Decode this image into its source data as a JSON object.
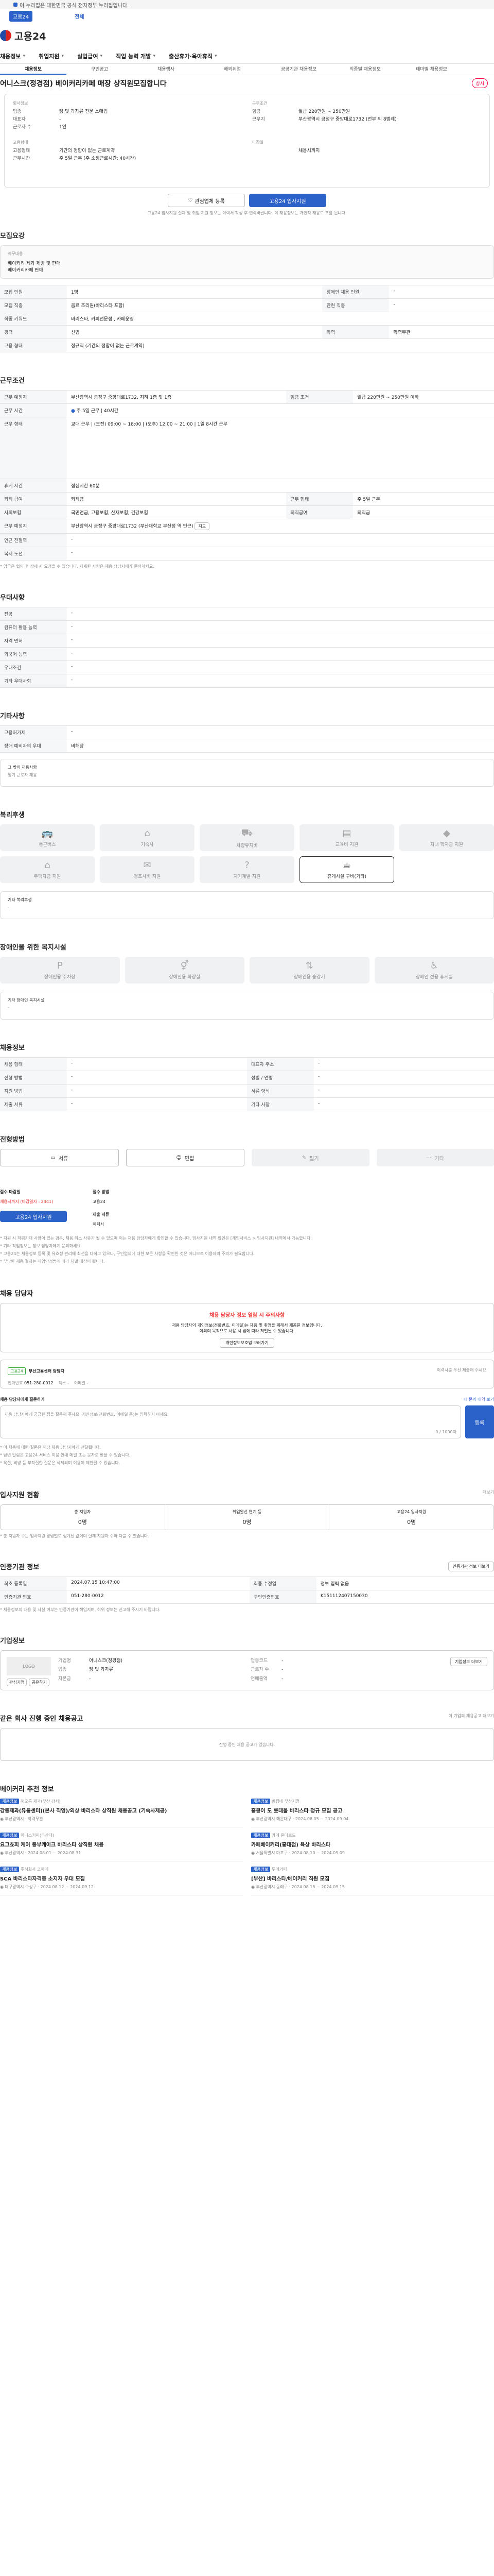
{
  "gov_banner": {
    "text": "이 누리집은 대한민국 공식 전자정부 누리집입니다."
  },
  "site_bar": {
    "pill": "고용24",
    "all_menu": "전체"
  },
  "header": {
    "logo_text": "고용24"
  },
  "gnb": [
    "채용정보",
    "취업지원",
    "실업급여",
    "직업 능력 개발",
    "출산휴가·육아휴직"
  ],
  "tabs": [
    "채용정보",
    "구인공고",
    "채용행사",
    "해외취업",
    "공공기관 채용정보",
    "직종별 채용정보",
    "테마별 채용정보"
  ],
  "job": {
    "title": "어니스크(정경점) 베이커리카페 매장 상직원모집합니다",
    "badge": "상시",
    "company_label": "회사정보",
    "company_rows": [
      {
        "k": "업종",
        "v": "빵 및 과자류 전문 소매업"
      },
      {
        "k": "대표자",
        "v": "-"
      },
      {
        "k": "근로자 수",
        "v": "1인"
      }
    ],
    "apply_label": "근무조건",
    "apply_rows": [
      {
        "k": "임금",
        "v": "월급 220만원 ~ 250만원"
      },
      {
        "k": "근무지",
        "v": "부산광역시 금정구 중앙대로1732 (전부 외 8범례)"
      }
    ],
    "req_label": "고용형태",
    "req_rows": [
      {
        "k": "고용형태",
        "v": "기간의 정함이 없는 근로계약"
      },
      {
        "k": "근무시간",
        "v": "주 5일 근무 (주 소정근로시간: 40시간)"
      }
    ],
    "deadline_label": "마감일",
    "deadline_value": "채용시까지",
    "btn_interest": "관심업체 등록",
    "btn_apply": "고용24 입사지원",
    "notice": "고용24 입사지원 절차 및 취업 지원 정보는 이력서 작성 후 연락바랍니다. 이 채용정보는 개인적 채용도 포함 됩니다."
  },
  "recruit": {
    "title": "모집요강",
    "box_rows": [
      "직무내용",
      "베이커리 제과 제빵 및 판매",
      "베이커리카페 판매"
    ],
    "rows": [
      {
        "k": "모집 인원",
        "v": "1명",
        "k2": "장애인 채용 인원",
        "v2": "-"
      },
      {
        "k": "모집 직종",
        "v": "음료 조리원(바리스타 포함)",
        "k2": "관련 직종",
        "v2": "-"
      },
      {
        "k": "직종 키워드",
        "v": "바리스타, 커피전문점 , 카페운영",
        "k2": "",
        "v2": ""
      },
      {
        "k": "경력",
        "v": "신입",
        "k2": "학력",
        "v2": "학력무관"
      },
      {
        "k": "고용 형태",
        "v": "정규직 (기간의 정함이 없는 근로계약)",
        "k2": "",
        "v2": ""
      }
    ]
  },
  "work": {
    "title": "근무조건",
    "rows": [
      {
        "k": "근무 예정지",
        "v": "부산광역시 금정구 중앙대로1732, 지하 1층 및 1층",
        "k2": "임금 조건",
        "v2": "월급 220만원 ~ 250만원 이하"
      },
      {
        "k": "근무 시간",
        "v": "주 5일 근무 | 40시간",
        "k2": "",
        "v2": ""
      },
      {
        "k": "근무 형태",
        "v": "교대 근무 | (오전) 09:00 ~ 18:00 | (오후) 12:00 ~ 21:00 | 1일 8시간 근무",
        "k2": "",
        "v2": ""
      },
      {
        "k": "휴게 시간",
        "v": "점심시간 60분",
        "k2": "",
        "v2": ""
      },
      {
        "k": "퇴직 급여",
        "v": "퇴직금",
        "k2": "근무 형태",
        "v2": "주 5일 근무"
      },
      {
        "k": "사회보험",
        "v": "국민연금, 고용보험, 산재보험, 건강보험",
        "k2": "퇴직급여",
        "v2": "퇴직금"
      },
      {
        "k": "근무 예정지",
        "v": "부산광역시 금정구 중앙대로1732 (부산대학교 부산정 역 인근)",
        "k2": "",
        "v2": ""
      },
      {
        "k": "인근 전철역",
        "v": "-",
        "k2": "",
        "v2": ""
      },
      {
        "k": "복지 노선",
        "v": "-",
        "k2": "",
        "v2": ""
      }
    ],
    "note": "* 임금은 협의 후 상세 시 요청을 수 있습니다. 자세한 사항은 채용 담당자에게 문의하세요."
  },
  "pref": {
    "title": "우대사항",
    "rows": [
      {
        "k": "전공",
        "v": "-"
      },
      {
        "k": "컴퓨터 활용 능력",
        "v": "-"
      },
      {
        "k": "자격 면허",
        "v": "-"
      },
      {
        "k": "외국어 능력",
        "v": "-"
      },
      {
        "k": "우대조건",
        "v": "-"
      },
      {
        "k": "기타 우대사항",
        "v": "-"
      }
    ]
  },
  "etc": {
    "title": "기타사항",
    "rows": [
      {
        "k": "고용허가제",
        "v": "-"
      },
      {
        "k": "장애 예비자의 우대",
        "v": "비해당"
      }
    ],
    "box_title": "그 밖의 채용사항",
    "box_text": "정기 근로자 채용"
  },
  "welfare": {
    "title": "복리후생",
    "icons": [
      "통근버스",
      "기숙사",
      "차량유지비",
      "교육비 지원",
      "자녀 학자금 지원",
      "주택자금 지원",
      "경조사비 지원",
      "자기계발 지원",
      "휴게시설 구비(기타)"
    ],
    "box_title": "기타 복리후생",
    "box_text": "-"
  },
  "disabled": {
    "title": "장애인을 위한 복지시설",
    "icons": [
      "장애인용 주차장",
      "장애인용 화장실",
      "장애인용 승강기",
      "장애인 전용 휴게실"
    ],
    "box_title": "기타 장애인 복지시설",
    "box_text": "-"
  },
  "company": {
    "title": "채용정보",
    "rows": [
      {
        "k": "채용 형태",
        "v": "-",
        "k2": "",
        "v2": ""
      },
      {
        "k": "전형 방법",
        "v": "-",
        "k2": "",
        "v2": ""
      },
      {
        "k": "지원 방법",
        "v": "-",
        "k2": "",
        "v2": ""
      },
      {
        "k": "제출 서류",
        "v": "-",
        "k2": "",
        "v2": ""
      }
    ],
    "side_rows": [
      {
        "k": "대표자 주소",
        "v": "-"
      },
      {
        "k": "성별 / 연령",
        "v": "-"
      },
      {
        "k": "서류 양식",
        "v": "-"
      },
      {
        "k": "기타 사항",
        "v": "-"
      }
    ]
  },
  "process": {
    "title": "전형방법",
    "steps": [
      "서류",
      "면접",
      "필기",
      "기타"
    ]
  },
  "apply": {
    "deadline_k": "접수 마감일",
    "deadline_v": "채용시까지 (마감일자 : 2441)",
    "method_k": "접수 방법",
    "method_v": "고용24",
    "btn": "고용24 입사지원",
    "docs_k": "제출 서류",
    "docs_v": "이력서",
    "notes": [
      "* 지원 시 허위기재 사항이 있는 경우, 채용 취소 사유가 될 수 있으며 이는 채용 담당자에게 확인할 수 있습니다. 입사지원 내역 확인은 [개인서비스 > 입사지원] 내역에서 가능합니다.",
      "* 기타 직업정보는 정보 담당자에게 문의하세요.",
      "* 고용24는 채용정보 등록 및 유효성 관리에 최선을 다하고 있으나, 구인업체에 대한 모든 사항을 확인한 것은 아니므로 이용자의 주의가 필요합니다.",
      "* 부당한 채용 절차는 직업안정법에 따라 처벌 대상이 됩니다."
    ]
  },
  "contact": {
    "title": "채용 담당자",
    "notice_title": "채용 담당자 정보 열람 시 주의사항",
    "notice_lines": [
      "채용 담당자의 개인정보(전화번호, 이메일)는 채용 및 취업을 위해서 제공된 정보입니다.",
      "이외의 목적으로 사용 시 법에 따라 처벌될 수 있습니다."
    ],
    "notice_btn": "개인정보보호법 보러가기",
    "badge": "고용24",
    "name": "부산고용센터 담당자",
    "phone_k": "전화번호",
    "phone_v": "051-280-0012",
    "fax_k": "팩스",
    "fax_v": "-",
    "email_k": "이메일",
    "email_v": "-",
    "side_note": "이력서를 우선 제출해 주세요",
    "q_title": "채용 담당자에게 질문하기",
    "q_link": "내 문의 내역 보기",
    "q_placeholder": "채용 담당자에게 궁금한 점을 질문해 주세요. 개인정보(전화번호, 이메일 등)는 입력하지 마세요.",
    "q_count": "0 / 1000자",
    "q_btn": "등록",
    "q_notes": [
      "* 이 채용에 대한 질문은 해당 채용 담당자에게 전달됩니다.",
      "* 답변 알림은 고용24 서비스 이용 안내 메일 또는 문자로 받을 수 있습니다.",
      "* 욕설, 비방 등 부적절한 질문은 삭제되며 이용이 제한될 수 있습니다."
    ]
  },
  "applicants": {
    "title": "입사지원 현황",
    "link": "더보기",
    "cols": [
      {
        "k": "총 지원자",
        "v": "0명"
      },
      {
        "k": "취업알선 연계 등",
        "v": "0명"
      },
      {
        "k": "고용24 입사지원",
        "v": "0명"
      }
    ],
    "note": "* 총 지원자 수는 입사지원 방법별로 집계된 값이며 실제 지원자 수와 다를 수 있습니다."
  },
  "reg": {
    "title": "인증기관 정보",
    "btn": "인증기관 정보 더보기",
    "rows": [
      {
        "k": "최초 등록일",
        "v": "2024.07.15 10:47:00",
        "k2": "최종 수정일",
        "v2": "정보 입력 없음"
      },
      {
        "k": "인증기관 번호",
        "v": "051-280-0012",
        "k2": "구인인증번호",
        "v2": "K151112407150030"
      }
    ],
    "note": "* 채용정보의 내용 및 사실 여부는 인증기관이 책임지며, 허위 정보는 신고해 주시기 바랍니다."
  },
  "corp": {
    "title": "기업정보",
    "logo": "LOGO",
    "rows": [
      {
        "k": "기업명",
        "v": "어니스크(정경점)",
        "k2": "업종코드",
        "v2": "-"
      },
      {
        "k": "업종",
        "v": "빵 및 과자류",
        "k2": "근로자 수",
        "v2": "-"
      },
      {
        "k": "자본금",
        "v": "-",
        "k2": "연매출액",
        "v2": "-"
      }
    ],
    "btn": "기업정보 더보기",
    "tags": [
      "관심기업",
      "공유하기"
    ]
  },
  "similar": {
    "title": "같은 회사 진행 중인 채용공고",
    "link": "이 기업의 채용공고 더보기",
    "empty": "진행 중인 채용 공고가 없습니다."
  },
  "recommend": {
    "title": "베이커리 추천 정보",
    "items": [
      {
        "badge": "채용정보",
        "company": "해오름 제과(부산 강서)",
        "title": "강동제과(유통센터)(본사 직영)/외상 바리스타 상직원 채용공고 (기숙사제공)",
        "meta1": "부산광역시",
        "meta2": "학력무관"
      },
      {
        "badge": "채용정보",
        "company": "빵집네 부산지점",
        "title": "홍콩이 도 롯데몰 바리스타 정규 모집 공고",
        "meta1": "부산광역시 해운대구",
        "meta2": "2024.08.05 ~ 2024.09.04"
      },
      {
        "badge": "채용정보",
        "company": "이니스커피(부산대)",
        "title": "요그쵸피 케어 동부케이크 바리스타 상직원 채용",
        "meta1": "부산광역시",
        "meta2": "2024.08.01 ~ 2024.08.31"
      },
      {
        "badge": "채용정보",
        "company": "카페 온더로드",
        "title": "카페베이커리(홍대점) 육상 바리스타",
        "meta1": "서울특별시 마포구",
        "meta2": "2024.08.10 ~ 2024.09.09"
      },
      {
        "badge": "채용정보",
        "company": "주식회사 코파메",
        "title": "SCA 바리스타자격증 소지자 우대 모집",
        "meta1": "대구광역시 수성구",
        "meta2": "2024.08.12 ~ 2024.09.12"
      },
      {
        "badge": "채용정보",
        "company": "두레커피",
        "title": "[부산] 바리스타/베이커리 직원 모집",
        "meta1": "부산광역시 동래구",
        "meta2": "2024.08.15 ~ 2024.09.15"
      }
    ]
  }
}
